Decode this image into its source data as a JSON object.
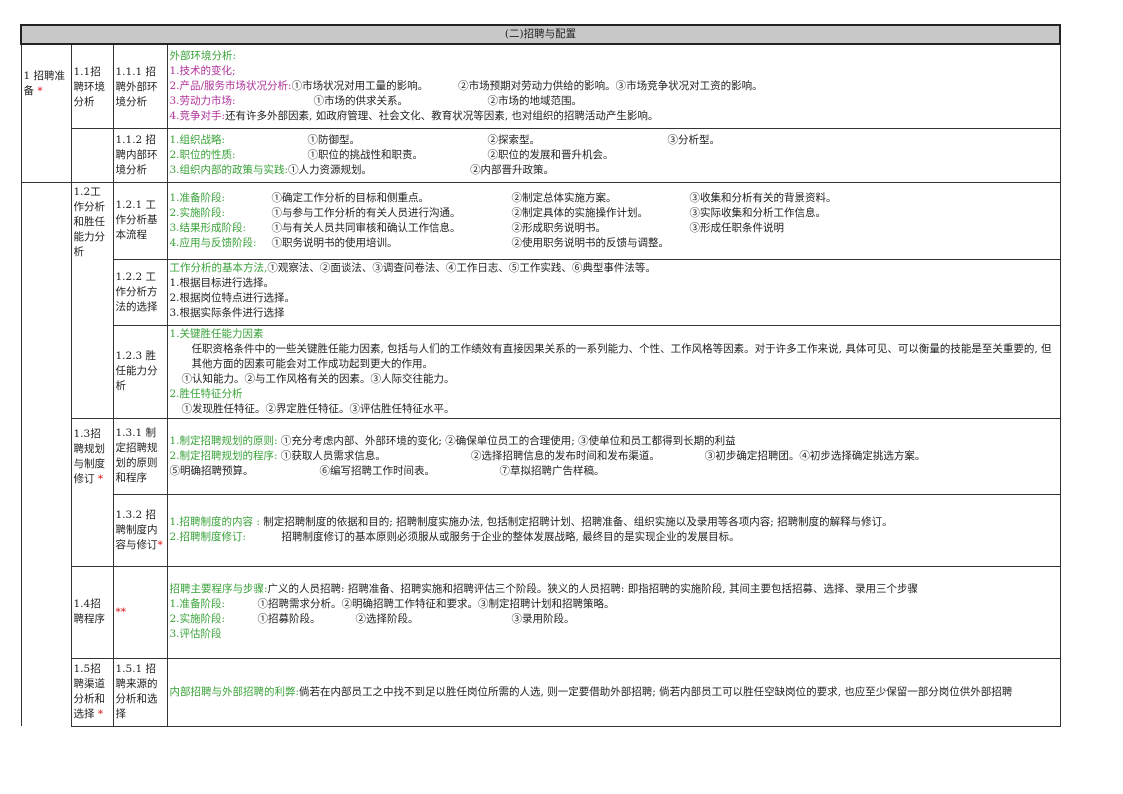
{
  "title": "(二)招聘与配置",
  "col1": {
    "label": "1 招聘准备",
    "star": "*"
  },
  "r11": {
    "sec": "1.1招聘环境分析",
    "sub": "1.1.1 招聘外部环境分析",
    "l0": "外部环境分析:",
    "l1": "1.技术的变化;",
    "l2a": "2.产品/服务市场状况分析:",
    "l2b": "①市场状况对用工量的影响。",
    "l2c": "②市场预期对劳动力供给的影响。",
    "l2d": "③市场竞争状况对工资的影响。",
    "l3a": "3.劳动力市场:",
    "l3b": "①市场的供求关系。",
    "l3c": "②市场的地域范围。",
    "l4a": "4.竞争对手:",
    "l4b": "还有许多外部因素, 如政府管理、社会文化、教育状况等因素, 也对组织的招聘活动产生影响。"
  },
  "r112": {
    "sub": "1.1.2 招聘内部环境分析",
    "l1a": "1.组织战略:",
    "l1b": "①防御型。",
    "l1c": "②探索型。",
    "l1d": "③分析型。",
    "l2a": "2.职位的性质:",
    "l2b": "①职位的挑战性和职责。",
    "l2c": "②职位的发展和晋升机会。",
    "l3a": "3.组织内部的政策与实践:",
    "l3b": "①人力资源规划。",
    "l3c": "②内部晋升政策。"
  },
  "r121": {
    "sec": "1.2工作分析和胜任能力分析",
    "sub": "1.2.1 工作分析基本流程",
    "l1a": "1.准备阶段:",
    "l1b": "①确定工作分析的目标和侧重点。",
    "l1c": "②制定总体实施方案。",
    "l1d": "③收集和分析有关的背景资料。",
    "l2a": "2.实施阶段:",
    "l2b": "①与参与工作分析的有关人员进行沟通。",
    "l2c": "②制定具体的实施操作计划。",
    "l2d": "③实际收集和分析工作信息。",
    "l3a": "3.结果形成阶段:",
    "l3b": "①与有关人员共同审核和确认工作信息。",
    "l3c": "②形成职务说明书。",
    "l3d": "③形成任职条件说明",
    "l4a": "4.应用与反馈阶段:",
    "l4b": "①职务说明书的使用培训。",
    "l4c": "②使用职务说明书的反馈与调整。"
  },
  "r122": {
    "sub": "1.2.2 工作分析方法的选择",
    "l0a": "工作分析的基本方法,",
    "l0b": "①观察法、②面谈法、③调查问卷法、④工作日志、⑤工作实践、⑥典型事件法等。",
    "l1": "1.根据目标进行选择。",
    "l2": "2.根据岗位特点进行选择。",
    "l3": "3.根据实际条件进行选择"
  },
  "r123": {
    "sub": "1.2.3 胜任能力分析",
    "l1": "1.关键胜任能力因素",
    "l2": "任职资格条件中的一些关键胜任能力因素, 包括与人们的工作绩效有直接因果关系的一系列能力、个性、工作风格等因素。对于许多工作来说, 具体可见、可以衡量的技能是至关重要的, 但其他方面的因素可能会对工作成功起到更大的作用。",
    "l3": "①认知能力。②与工作风格有关的因素。③人际交往能力。",
    "l4": "2.胜任特征分析",
    "l5": "①发现胜任特征。②界定胜任特征。③评估胜任特征水平。"
  },
  "r131": {
    "sec": "1.3招聘规划与制度修订",
    "star": "*",
    "sub": "1.3.1 制定招聘规划的原则和程序",
    "l1a": "1.制定招聘规划的原则:",
    "l1b": "①充分考虑内部、外部环境的变化; ②确保单位员工的合理使用; ③使单位和员工都得到长期的利益",
    "l2a": "2.制定招聘规划的程序:",
    "l2b": "①获取人员需求信息。",
    "l2c": "②选择招聘信息的发布时间和发布渠道。",
    "l2d": "③初步确定招聘团。④初步选择确定挑选方案。",
    "l3a": "⑤明确招聘预算。",
    "l3b": "⑥编写招聘工作时间表。",
    "l3c": "⑦草拟招聘广告样稿。"
  },
  "r132": {
    "sub": "1.3.2 招聘制度内容与修订",
    "star": "*",
    "l1a": "1.招聘制度的内容 :",
    "l1b": "制定招聘制度的依据和目的; 招聘制度实施办法, 包括制定招聘计划、招聘准备、组织实施以及录用等各项内容; 招聘制度的解释与修订。",
    "l2a": "2.招聘制度修订:",
    "l2b": "招聘制度修订的基本原则必须服从或服务于企业的整体发展战略, 最终目的是实现企业的发展目标。"
  },
  "r14": {
    "sec": "1.4招聘程序",
    "stars": "**",
    "l0a": "招聘主要程序与步骤:",
    "l0b": "广义的人员招聘: 招聘准备、招聘实施和招聘评估三个阶段。狭义的人员招聘: 即指招聘的实施阶段, 其间主要包括招募、选择、录用三个步骤",
    "l1a": "1.准备阶段:",
    "l1b": "①招聘需求分析。②明确招聘工作特征和要求。③制定招聘计划和招聘策略。",
    "l2a": "2.实施阶段:",
    "l2b": "①招募阶段。",
    "l2c": "②选择阶段。",
    "l2d": "③录用阶段。",
    "l3": "3.评估阶段"
  },
  "r15": {
    "sec": "1.5招聘渠道分析和选择",
    "star": "*",
    "sub": "1.5.1 招聘来源的分析和选择",
    "l1a": "内部招聘与外部招聘的利弊:",
    "l1b": "倘若在内部员工之中找不到足以胜任岗位所需的人选, 则一定要借助外部招聘; 倘若内部员工可以胜任空缺岗位的要求, 也应至少保留一部分岗位供外部招聘"
  },
  "colors": {
    "green": "#3aa23a",
    "magenta": "#b0339a",
    "red": "#dd1111",
    "header_bg": "#c8c8c8"
  }
}
